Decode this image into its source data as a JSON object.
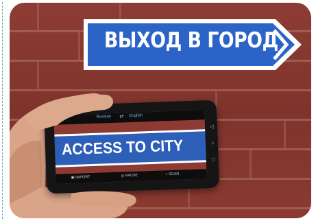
{
  "sign": {
    "text": "ВЫХОД В ГОРОД"
  },
  "phone": {
    "source_language": "Russian",
    "target_language": "English",
    "translated_text": "ACCESS TO CITY",
    "bottom_bar": {
      "import": "IMPORT",
      "pause": "PAUSE",
      "scan": "SCAN"
    }
  },
  "colors": {
    "brick": "#8d3c33",
    "sign_blue": "#2b63c6",
    "overlay_blue": "#2e5fb8"
  }
}
